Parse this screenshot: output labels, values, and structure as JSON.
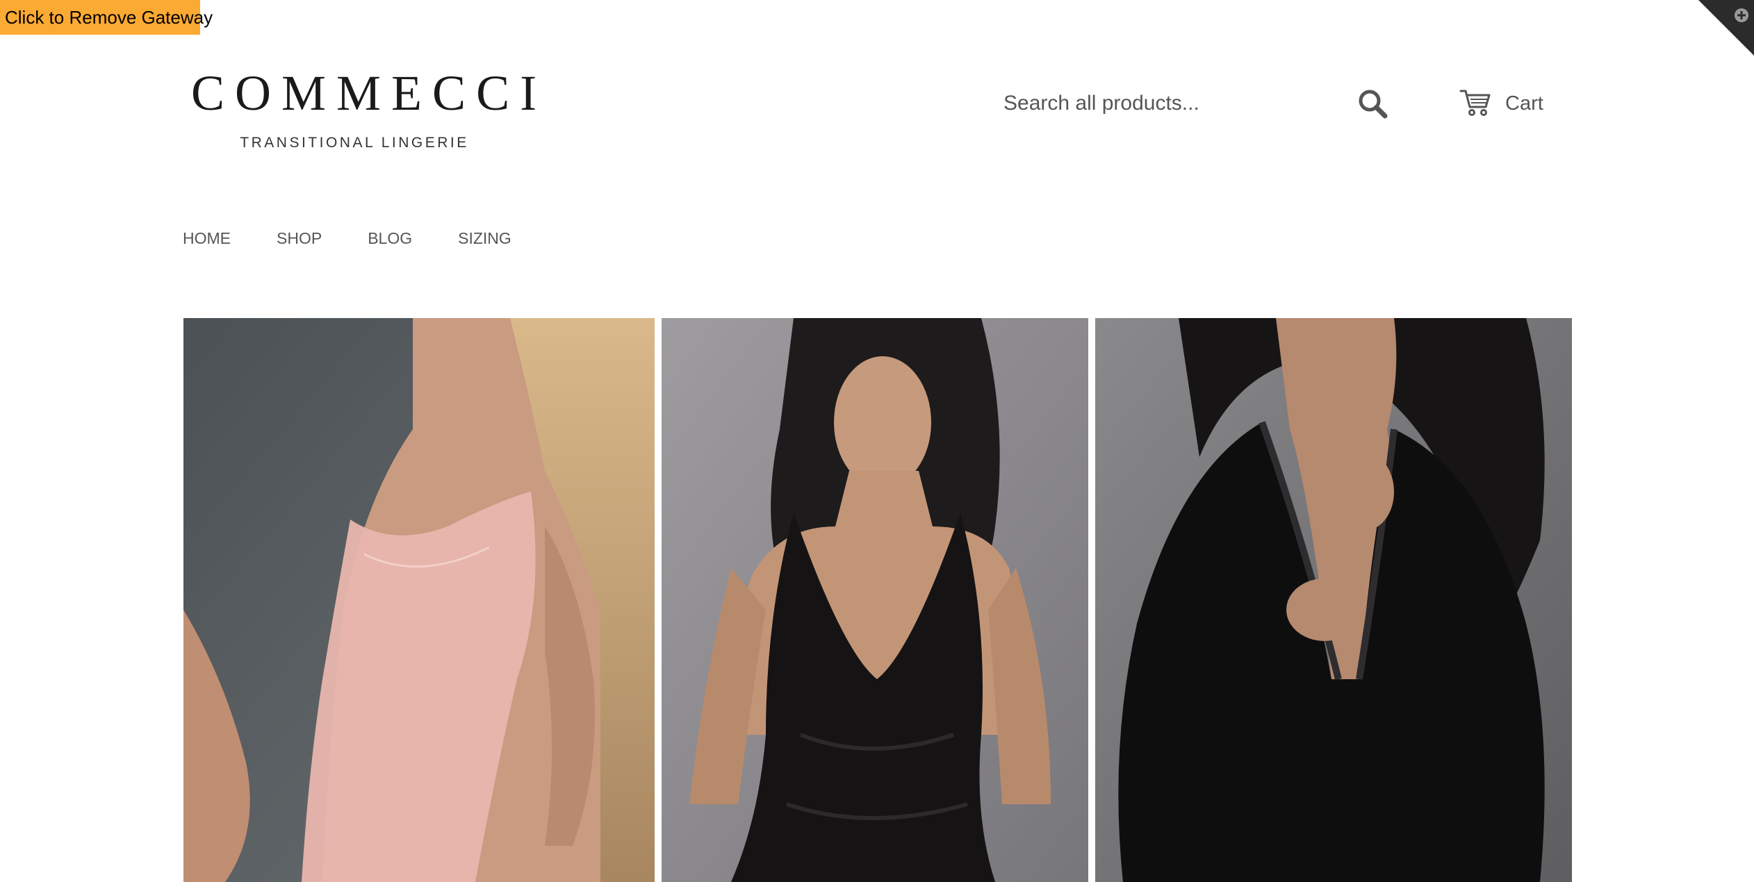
{
  "gateway": {
    "label": "Click to Remove Gateway",
    "bg_color": "#fbaa33"
  },
  "corner": {
    "icon": "plus-circle-icon"
  },
  "brand": {
    "title": "COMMECCI",
    "tagline": "TRANSITIONAL LINGERIE"
  },
  "search": {
    "placeholder": "Search all products...",
    "value": "",
    "button_icon": "search-icon"
  },
  "cart": {
    "label": "Cart",
    "icon": "cart-icon"
  },
  "nav": {
    "items": [
      {
        "label": "HOME"
      },
      {
        "label": "SHOP"
      },
      {
        "label": "BLOG"
      },
      {
        "label": "SIZING"
      }
    ]
  },
  "hero": {
    "panels": [
      {
        "tone": "pink-lace-slip"
      },
      {
        "tone": "black-lace-gown"
      },
      {
        "tone": "black-satin-robe"
      }
    ]
  },
  "colors": {
    "text": "#555555",
    "brand": "#1a1a1a",
    "accent": "#fbaa33"
  }
}
